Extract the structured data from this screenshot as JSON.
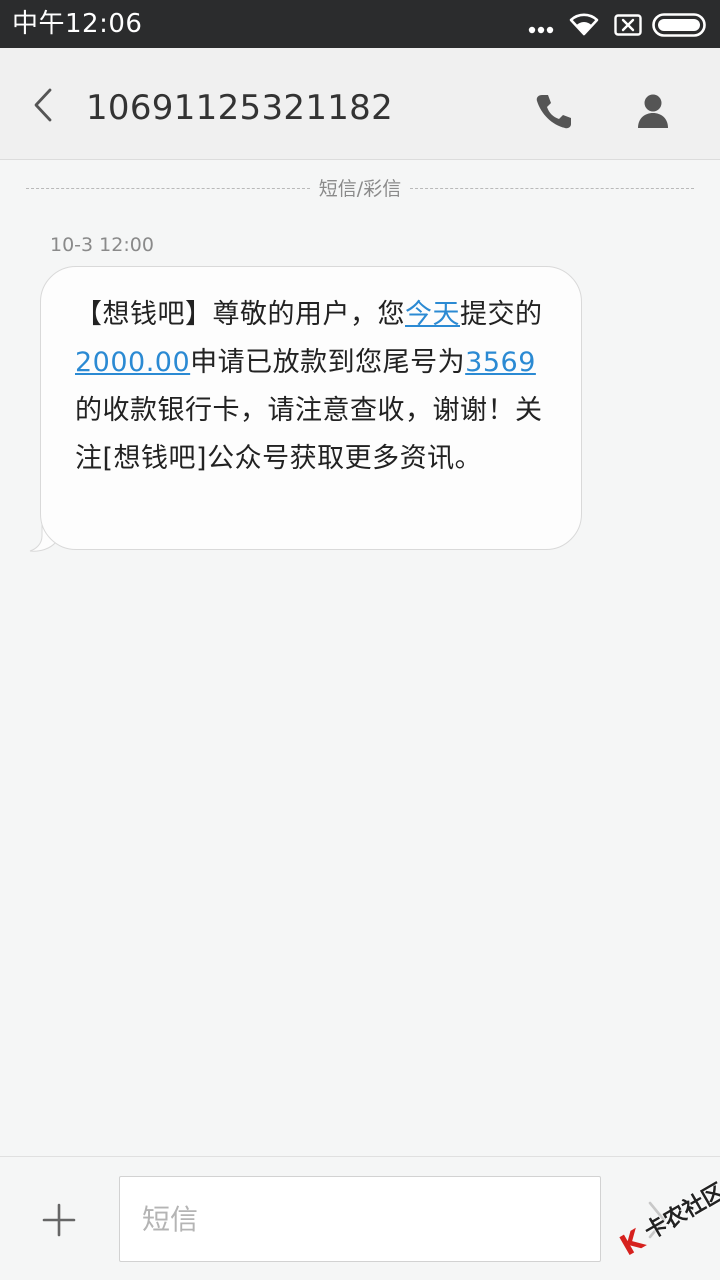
{
  "status_bar": {
    "time": "中午12:06",
    "icons": [
      "more-dots-icon",
      "wifi-icon",
      "sim-off-icon",
      "battery-icon"
    ]
  },
  "header": {
    "contact_number": "10691125321182",
    "icons": [
      "back-icon",
      "phone-icon",
      "contact-icon"
    ]
  },
  "conversation": {
    "channel_label": "短信/彩信",
    "messages": [
      {
        "time": "10-3 12:00",
        "segments": [
          {
            "text": "【想钱吧】尊敬的用户，您",
            "link": false
          },
          {
            "text": "今天",
            "link": true
          },
          {
            "text": "提交的",
            "link": false
          },
          {
            "text": "2000.00",
            "link": true
          },
          {
            "text": "申请已放款到您尾号为",
            "link": false
          },
          {
            "text": "3569",
            "link": true
          },
          {
            "text": "的收款银行卡，请注意查收，谢谢！关注[想钱吧]公众号获取更多资讯。",
            "link": false
          }
        ]
      }
    ]
  },
  "input_bar": {
    "placeholder": "短信",
    "value": "",
    "icons": [
      "add-icon",
      "send-icon"
    ]
  },
  "watermark": {
    "logo": "K",
    "text": "卡农社区"
  },
  "colors": {
    "status_bar": "#2b2c2d",
    "header": "#f0f0f0",
    "background": "#f5f6f6",
    "link": "#2b8ad3",
    "watermark_red": "#d6211e"
  }
}
